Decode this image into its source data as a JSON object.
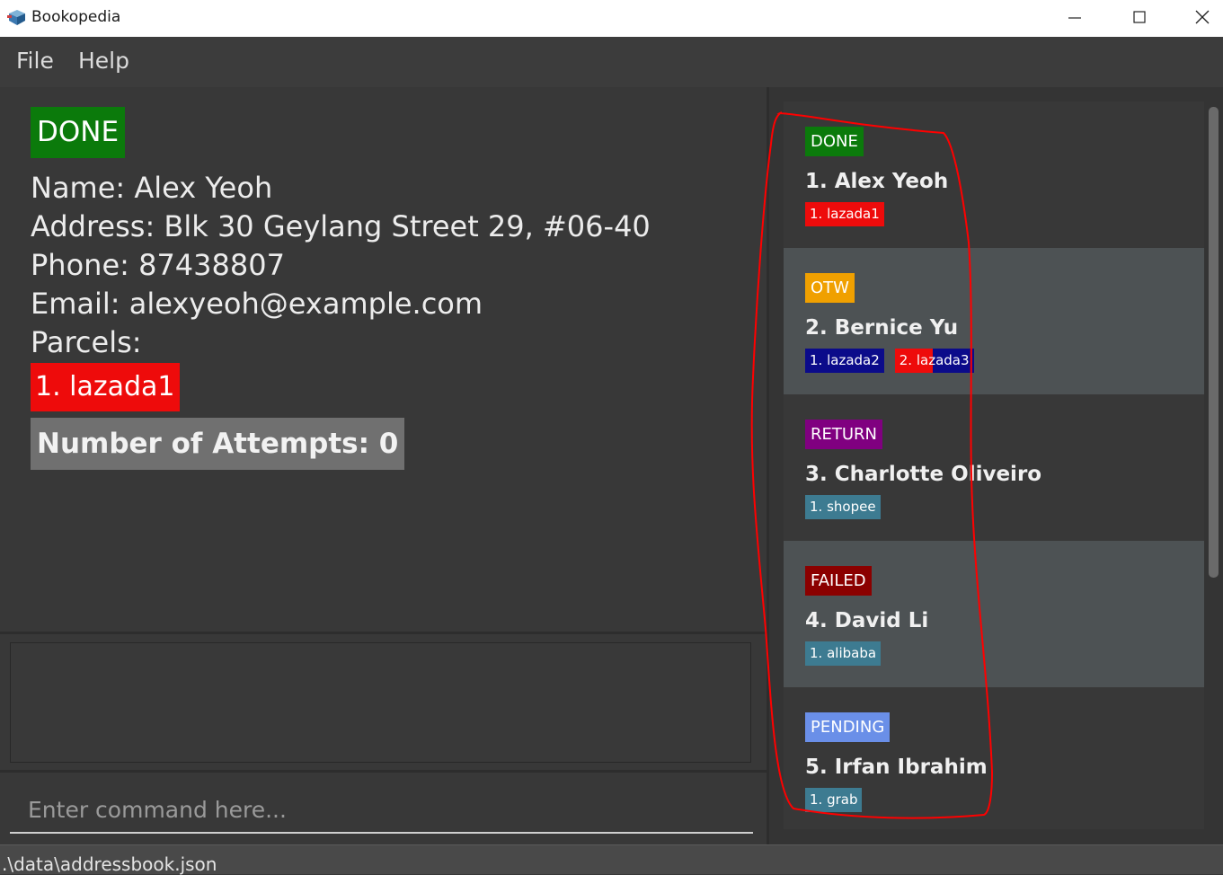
{
  "window": {
    "title": "Bookopedia",
    "minimize_icon": "minimize-icon",
    "maximize_icon": "maximize-icon",
    "close_icon": "close-icon"
  },
  "menu": [
    {
      "label": "File"
    },
    {
      "label": "Help"
    }
  ],
  "detail": {
    "status": "DONE",
    "status_color": "#0b7a0b",
    "name": "Name: Alex Yeoh",
    "address": "Address: Blk 30 Geylang Street 29, #06-40",
    "phone": "Phone: 87438807",
    "email": "Email: alexyeoh@example.com",
    "parcels_label": "Parcels:",
    "parcel_tag": "1. lazada1",
    "parcel_tag_color": "#ee0b0b",
    "attempts": "Number of Attempts: 0"
  },
  "command": {
    "placeholder": "Enter command here..."
  },
  "status_bar": {
    "path": ".\\data\\addressbook.json"
  },
  "contacts": [
    {
      "status": "DONE",
      "status_color": "#0b7a0b",
      "name": "1.  Alex Yeoh",
      "tags": [
        {
          "label": "1. lazada1",
          "color": "#ee0b0b"
        }
      ]
    },
    {
      "status": "OTW",
      "status_color": "#f0a000",
      "name": "2.  Bernice Yu",
      "tags": [
        {
          "label": "1. lazada2",
          "color": "#0b0b8a"
        },
        {
          "label": "2. lazada3",
          "color": "#0b0b8a"
        }
      ]
    },
    {
      "status": "RETURN",
      "status_color": "#800080",
      "name": "3.  Charlotte Oliveiro",
      "tags": [
        {
          "label": "1. shopee",
          "color": "#3d7b91"
        }
      ]
    },
    {
      "status": "FAILED",
      "status_color": "#8b0000",
      "name": "4.  David Li",
      "tags": [
        {
          "label": "1. alibaba",
          "color": "#3d7b91"
        }
      ]
    },
    {
      "status": "PENDING",
      "status_color": "#6a8fe8",
      "name": "5.  Irfan Ibrahim",
      "tags": [
        {
          "label": "1. grab",
          "color": "#3d7b91"
        }
      ]
    }
  ],
  "colors": {
    "background": "#383838",
    "card_alt": "#4d5254",
    "annotation": "#ff0000"
  }
}
